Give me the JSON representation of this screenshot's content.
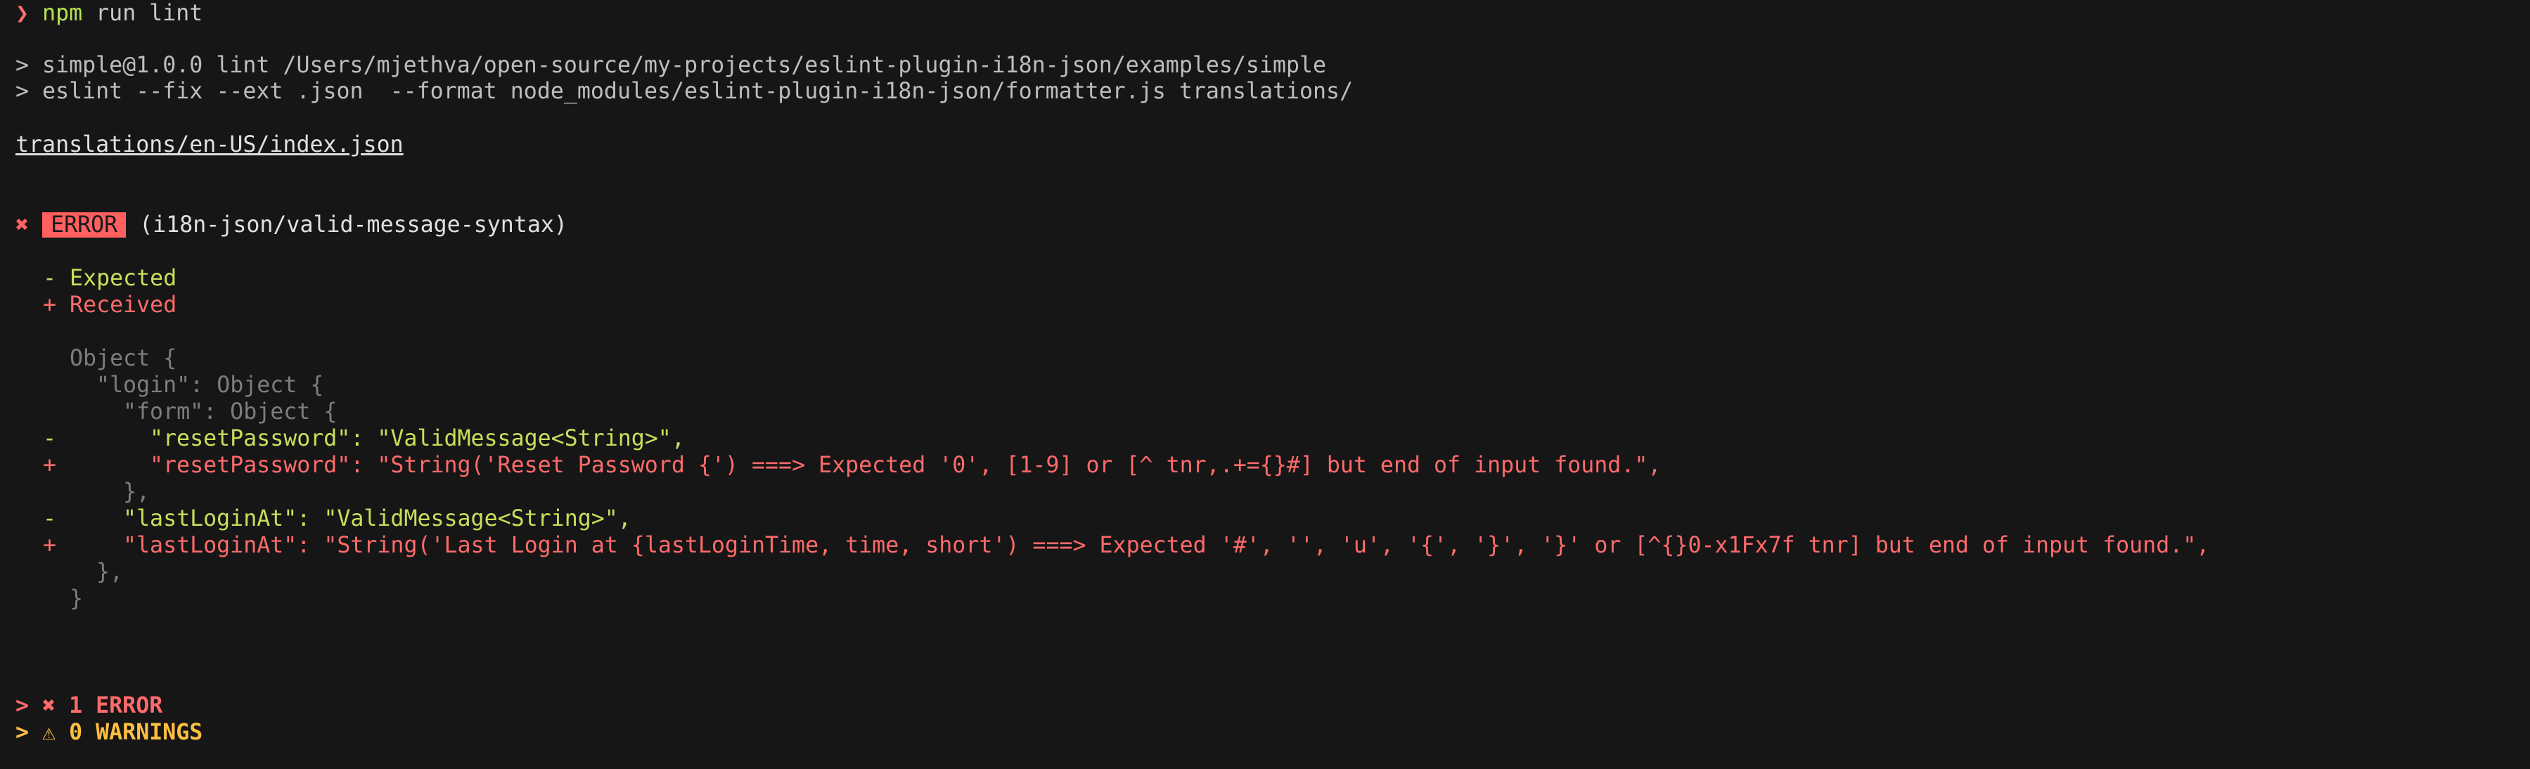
{
  "terminal": {
    "prompt_symbol": "❯",
    "command": {
      "program": "npm",
      "args": " run lint"
    },
    "script_info_1": "> simple@1.0.0 lint /Users/mjethva/open-source/my-projects/eslint-plugin-i18n-json/examples/simple",
    "script_info_2": "> eslint --fix --ext .json  --format node_modules/eslint-plugin-i18n-json/formatter.js translations/",
    "file_path": "translations/en-US/index.json",
    "error": {
      "icon": "✖",
      "badge": "ERROR",
      "rule": "(i18n-json/valid-message-syntax)"
    },
    "legend": {
      "expected": "- Expected",
      "received": "+ Received"
    },
    "diff": {
      "open_object": "Object {",
      "login_key": "\"login\": Object {",
      "form_key": "\"form\": Object {",
      "minus": "-",
      "plus": "+",
      "reset_expected": "\"resetPassword\": \"ValidMessage<String>\",",
      "reset_received": "\"resetPassword\": \"String('Reset Password {') ===> Expected '0', [1-9] or [^ tnr,.+={}#] but end of input found.\",",
      "close_form": "},",
      "last_expected": "\"lastLoginAt\": \"ValidMessage<String>\",",
      "last_received": "\"lastLoginAt\": \"String('Last Login at {lastLoginTime, time, short') ===> Expected '#', '', 'u', '{', '}', '}' or [^{}0-x1Fx7f tnr] but end of input found.\",",
      "close_login": "},",
      "close_object": "}"
    },
    "summary": {
      "errors": "> ✖ 1 ERROR",
      "warnings": "> ⚠ 0 WARNINGS"
    }
  },
  "colors": {
    "background": "#161616",
    "error_badge": "#ff5f5f",
    "expected_green": "#c6e05a",
    "received_red": "#ff6a6a",
    "warning_yellow": "#ffbf40"
  }
}
